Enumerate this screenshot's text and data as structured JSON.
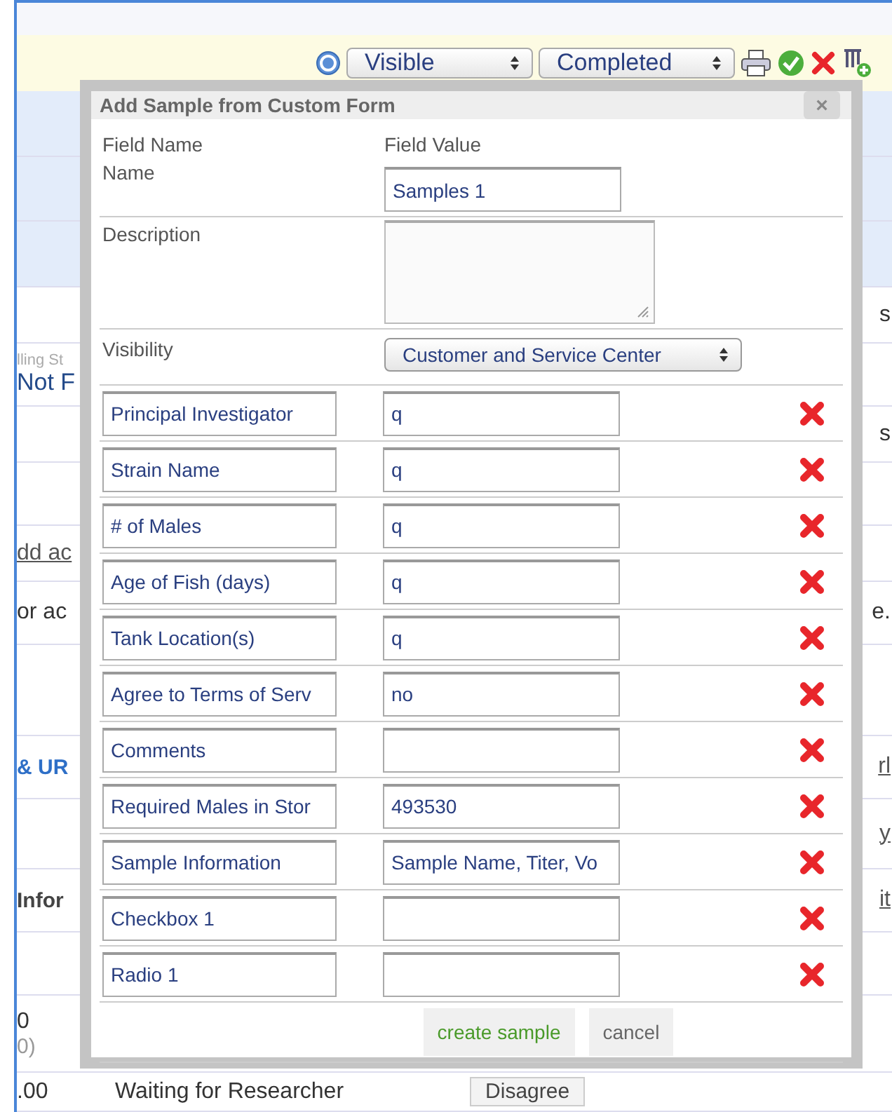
{
  "toolbar": {
    "visibility_select": "Visible",
    "status_select": "Completed"
  },
  "background_rows": [
    {
      "highlighted": true
    },
    {
      "highlighted": true
    },
    {
      "highlighted": true
    },
    {
      "highlighted": false,
      "right": {
        "text": "s",
        "kind": "plain"
      }
    },
    {
      "highlighted": false,
      "left_caption": "lling St",
      "left": {
        "text": "Not F",
        "kind": "value"
      }
    },
    {
      "highlighted": false,
      "right": {
        "text": "s",
        "kind": "plain"
      }
    },
    {
      "highlighted": false
    },
    {
      "highlighted": false,
      "left": {
        "text": "dd ac",
        "kind": "link"
      }
    },
    {
      "highlighted": false,
      "left": {
        "text": "or ac",
        "kind": "plain"
      },
      "right": {
        "text": "e.",
        "kind": "plain"
      }
    },
    {
      "highlighted": false
    },
    {
      "highlighted": false,
      "left": {
        "text": "& UR",
        "kind": "heading"
      },
      "right": {
        "text": "rl",
        "kind": "link"
      }
    },
    {
      "highlighted": false,
      "right": {
        "text": "y",
        "kind": "link"
      }
    },
    {
      "highlighted": false,
      "left": {
        "text": "Infor",
        "kind": "bold"
      },
      "right": {
        "text": "it",
        "kind": "link"
      }
    },
    {
      "highlighted": false
    },
    {
      "highlighted": false,
      "left": {
        "text": "0",
        "kind": "plain"
      },
      "left_caption_below": "0)"
    },
    {
      "highlighted": false,
      "left": {
        "text": ".00",
        "kind": "plain"
      },
      "middle": "Waiting for Researcher",
      "button": "Disagree"
    }
  ],
  "dialog": {
    "title": "Add Sample from Custom Form",
    "close": "×",
    "columns": [
      "Field Name",
      "Field Value"
    ],
    "fixed_fields": [
      {
        "kind": "text",
        "label": "Name",
        "value": "Samples 1"
      },
      {
        "kind": "textarea",
        "label": "Description"
      },
      {
        "kind": "select",
        "label": "Visibility",
        "value": "Customer and Service Center"
      }
    ],
    "custom_fields": [
      {
        "name": "Principal Investigator",
        "value": "q"
      },
      {
        "name": "Strain Name",
        "value": "q"
      },
      {
        "name": "# of Males",
        "value": "q"
      },
      {
        "name": "Age of Fish (days)",
        "value": "q"
      },
      {
        "name": "Tank Location(s)",
        "value": "q"
      },
      {
        "name": "Agree to Terms of Serv",
        "value": "no"
      },
      {
        "name": "Comments"
      },
      {
        "name": "Required Males in Stor",
        "value": "493530"
      },
      {
        "name": "Sample Information",
        "value": "Sample Name, Titer, Vo"
      },
      {
        "name": "Checkbox 1"
      },
      {
        "name": "Radio 1"
      }
    ],
    "buttons": [
      {
        "label": "create sample",
        "kind": "primary"
      },
      {
        "label": "cancel",
        "kind": "secondary"
      }
    ]
  }
}
